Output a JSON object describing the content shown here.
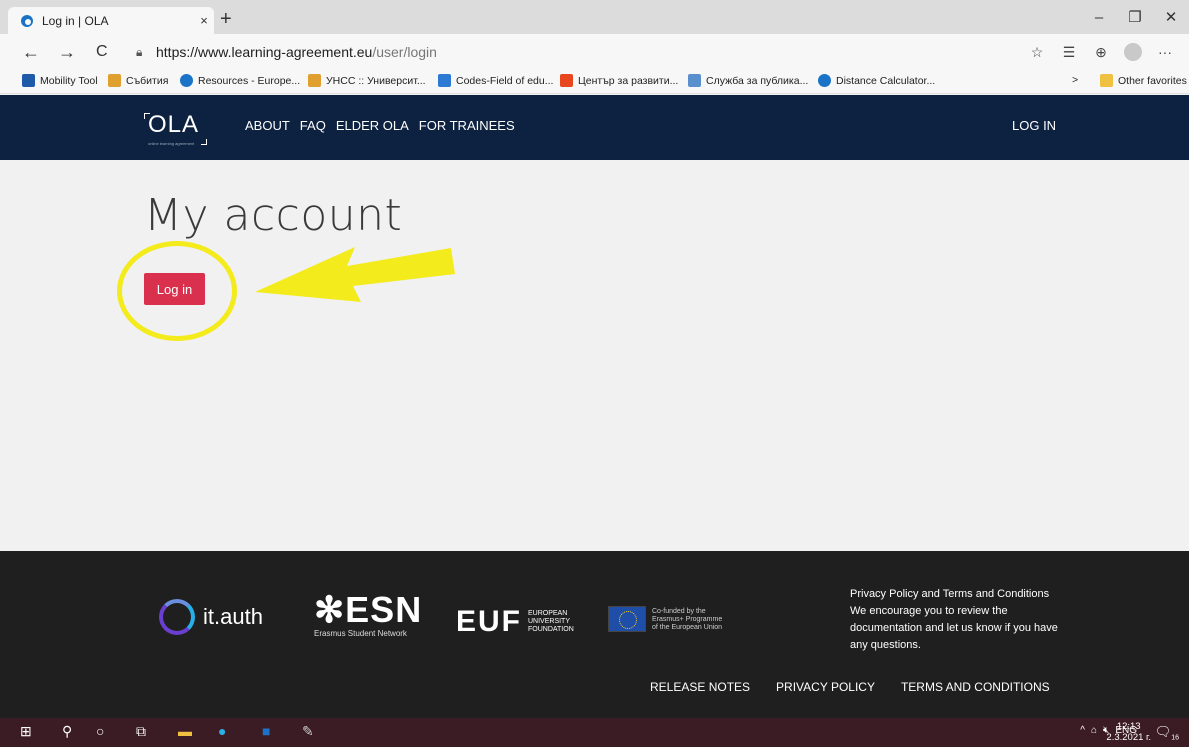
{
  "browser": {
    "tab_title": "Log in | OLA",
    "tab_close": "×",
    "new_tab": "+",
    "url_host": "https://www.learning-agreement.eu",
    "url_path": "/user/login",
    "back": "←",
    "forward": "→",
    "reload": "C",
    "more": "···",
    "win_min": "–",
    "win_max": "❐",
    "win_close": "✕"
  },
  "favorites": {
    "items": [
      {
        "label": "Mobility Tool",
        "color": "#1e5aa8"
      },
      {
        "label": "Събития",
        "color": "#e0a030"
      },
      {
        "label": "Resources - Europe...",
        "color": "#1a73c7"
      },
      {
        "label": "УНСС :: Университ...",
        "color": "#e0a030"
      },
      {
        "label": "Codes-Field of edu...",
        "color": "#2c7ad3"
      },
      {
        "label": "Център за развити...",
        "color": "#e8461e"
      },
      {
        "label": "Служба за публика...",
        "color": "#5a8fce"
      },
      {
        "label": "Distance Calculator...",
        "color": "#1a73c7"
      }
    ],
    "overflow": ">",
    "other": "Other favorites"
  },
  "site": {
    "logo": "OLA",
    "logo_sub": "online learning agreement",
    "menu": [
      "ABOUT",
      "FAQ",
      "ELDER OLA",
      "FOR TRAINEES"
    ],
    "login_link": "LOG IN"
  },
  "main": {
    "heading": "My account",
    "login_button": "Log in"
  },
  "footer": {
    "ithauth": "it.auth",
    "esn_big": "✻ESN",
    "esn_small": "Erasmus Student Network",
    "euf_big": "EUF",
    "euf_text": [
      "EUROPEAN",
      "UNIVERSITY",
      "FOUNDATION"
    ],
    "eu_text": [
      "Co-funded by the",
      "Erasmus+ Programme",
      "of the European Union"
    ],
    "privacy_title": "Privacy Policy and Terms and Conditions",
    "privacy_body": "We encourage you to review the documentation and let us know if you have any questions.",
    "links": [
      "RELEASE NOTES",
      "PRIVACY POLICY",
      "TERMS AND CONDITIONS"
    ]
  },
  "taskbar": {
    "lang": "ENG",
    "time": "12:13",
    "date": "2.3.2021 г.",
    "notif_count": "16"
  }
}
